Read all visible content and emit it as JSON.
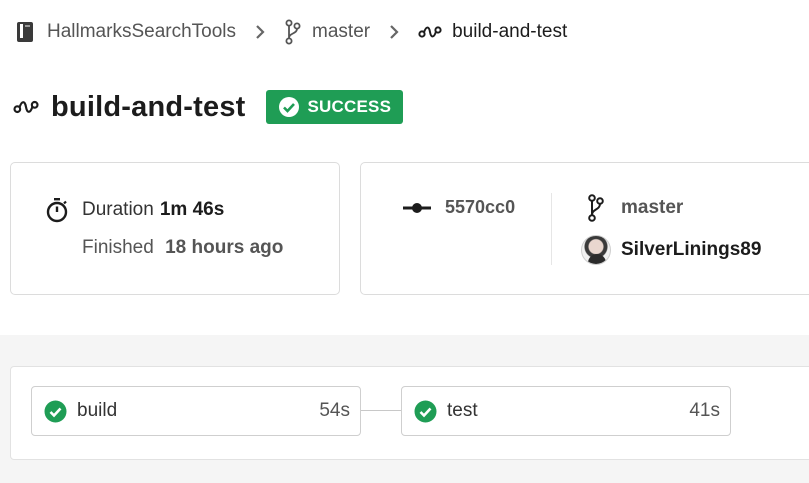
{
  "breadcrumb": {
    "repo": "HallmarksSearchTools",
    "branch": "master",
    "workflow": "build-and-test"
  },
  "header": {
    "title": "build-and-test",
    "status": "SUCCESS"
  },
  "summary": {
    "duration_label": "Duration",
    "duration_value": "1m 46s",
    "finished_label": "Finished",
    "finished_value": "18 hours ago",
    "commit": "5570cc0",
    "branch": "master",
    "user": "SilverLinings89"
  },
  "pipeline": {
    "jobs": [
      {
        "name": "build",
        "duration": "54s",
        "status": "success"
      },
      {
        "name": "test",
        "duration": "41s",
        "status": "success"
      }
    ]
  },
  "colors": {
    "success": "#1f9d55",
    "text": "#1c1c1c",
    "muted": "#555555"
  }
}
